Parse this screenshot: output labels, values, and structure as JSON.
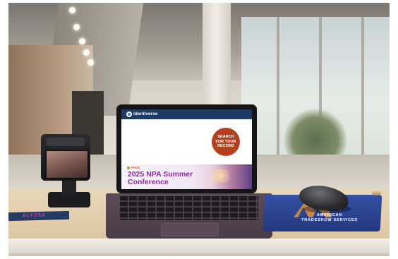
{
  "tablet_screen": {
    "brand": "identiverse",
    "search_button": [
      "SEARCH",
      "FOR YOUR",
      "RECORD"
    ],
    "pace_label": "PACE",
    "conference_title": [
      "2025 NPA Summer",
      "Conference"
    ]
  },
  "badge_text": "ALYSSA",
  "mousepad_text": [
    "AMERICAN",
    "TRADESHOW SERVICES"
  ],
  "colors": {
    "topbar": "#1d3a64",
    "search_button": "#b2401f",
    "conference_title": "#8b2aa1",
    "mousepad": "#2c4493"
  }
}
